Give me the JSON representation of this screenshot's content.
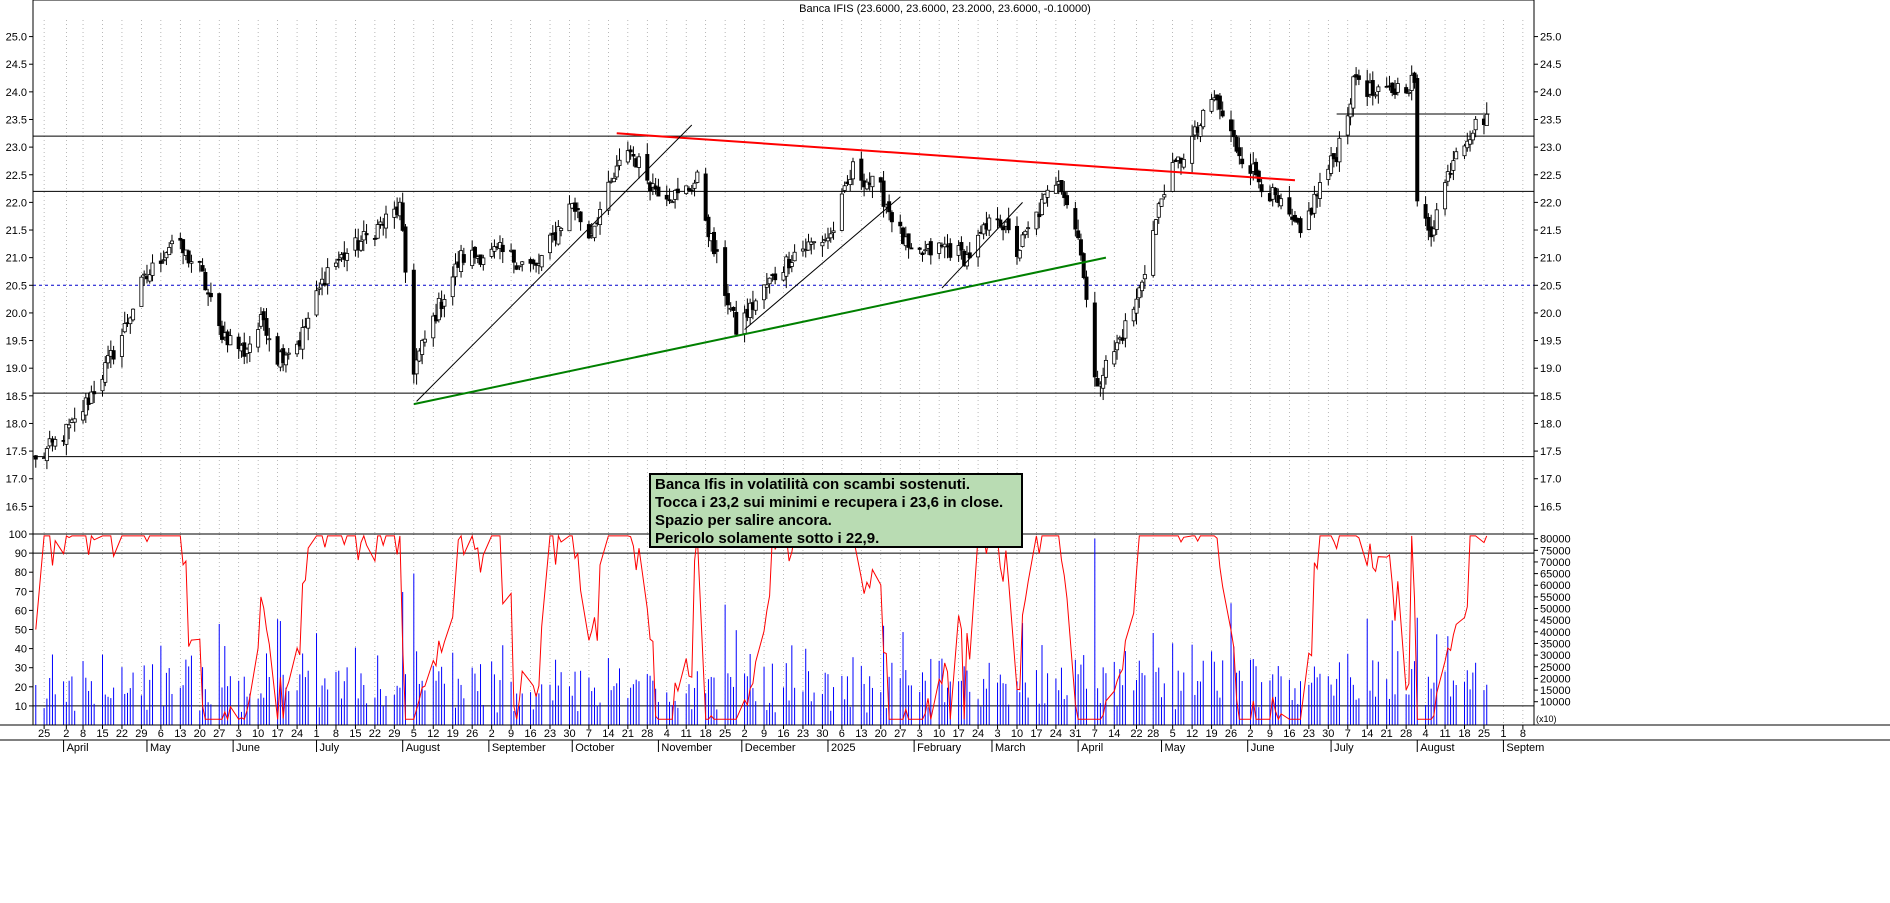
{
  "chart_data": [
    {
      "type": "candlestick",
      "title": "Banca IFIS (23.6000, 23.6000, 23.2000, 23.6000, -0.10000)",
      "ylim": [
        16.0,
        25.3
      ],
      "yticks": [
        16.5,
        17.0,
        17.5,
        18.0,
        18.5,
        19.0,
        19.5,
        20.0,
        20.5,
        21.0,
        21.5,
        22.0,
        22.5,
        23.0,
        23.5,
        24.0,
        24.5,
        25.0
      ],
      "ytick_labels": [
        "16.5",
        "17.0",
        "17.5",
        "18.0",
        "18.5",
        "19.0",
        "19.5",
        "20.0",
        "20.5",
        "21.0",
        "21.5",
        "22.0",
        "22.5",
        "23.0",
        "23.5",
        "24.0",
        "24.5",
        "25.0"
      ],
      "horizontal_levels": [
        23.2,
        22.2,
        18.55,
        17.4
      ],
      "dashed_level": 20.5,
      "close_series": {
        "start_date": "2024-03-22",
        "end_date": "2025-08-26",
        "anchors": [
          {
            "date": "2024-03-22",
            "value": 17.3
          },
          {
            "date": "2024-04-05",
            "value": 18.0
          },
          {
            "date": "2024-04-15",
            "value": 18.9
          },
          {
            "date": "2024-04-22",
            "value": 19.6
          },
          {
            "date": "2024-04-29",
            "value": 20.5
          },
          {
            "date": "2024-05-10",
            "value": 21.3
          },
          {
            "date": "2024-05-20",
            "value": 20.8
          },
          {
            "date": "2024-05-27",
            "value": 19.7
          },
          {
            "date": "2024-06-05",
            "value": 19.3
          },
          {
            "date": "2024-06-12",
            "value": 19.9
          },
          {
            "date": "2024-06-17",
            "value": 19.2
          },
          {
            "date": "2024-06-25",
            "value": 19.5
          },
          {
            "date": "2024-07-05",
            "value": 20.8
          },
          {
            "date": "2024-07-15",
            "value": 21.2
          },
          {
            "date": "2024-07-31",
            "value": 21.9
          },
          {
            "date": "2024-08-05",
            "value": 19.0
          },
          {
            "date": "2024-08-13",
            "value": 20.0
          },
          {
            "date": "2024-08-22",
            "value": 21.0
          },
          {
            "date": "2024-09-05",
            "value": 21.1
          },
          {
            "date": "2024-09-18",
            "value": 20.8
          },
          {
            "date": "2024-10-01",
            "value": 22.0
          },
          {
            "date": "2024-10-07",
            "value": 21.4
          },
          {
            "date": "2024-10-21",
            "value": 23.0
          },
          {
            "date": "2024-10-30",
            "value": 22.3
          },
          {
            "date": "2024-11-08",
            "value": 22.1
          },
          {
            "date": "2024-11-15",
            "value": 22.4
          },
          {
            "date": "2024-11-20",
            "value": 21.3
          },
          {
            "date": "2024-11-29",
            "value": 19.7
          },
          {
            "date": "2024-12-10",
            "value": 20.5
          },
          {
            "date": "2024-12-20",
            "value": 21.1
          },
          {
            "date": "2025-01-02",
            "value": 21.4
          },
          {
            "date": "2025-01-10",
            "value": 22.6
          },
          {
            "date": "2025-01-20",
            "value": 22.2
          },
          {
            "date": "2025-01-31",
            "value": 21.0
          },
          {
            "date": "2025-02-12",
            "value": 21.2
          },
          {
            "date": "2025-02-20",
            "value": 21.0
          },
          {
            "date": "2025-03-03",
            "value": 21.8
          },
          {
            "date": "2025-03-10",
            "value": 21.1
          },
          {
            "date": "2025-03-25",
            "value": 22.5
          },
          {
            "date": "2025-04-02",
            "value": 21.2
          },
          {
            "date": "2025-04-07",
            "value": 18.7
          },
          {
            "date": "2025-04-14",
            "value": 19.3
          },
          {
            "date": "2025-04-22",
            "value": 20.2
          },
          {
            "date": "2025-05-02",
            "value": 22.3
          },
          {
            "date": "2025-05-14",
            "value": 23.3
          },
          {
            "date": "2025-05-20",
            "value": 23.9
          },
          {
            "date": "2025-05-28",
            "value": 23.0
          },
          {
            "date": "2025-06-04",
            "value": 22.5
          },
          {
            "date": "2025-06-13",
            "value": 21.9
          },
          {
            "date": "2025-06-20",
            "value": 21.4
          },
          {
            "date": "2025-06-27",
            "value": 22.3
          },
          {
            "date": "2025-07-03",
            "value": 22.9
          },
          {
            "date": "2025-07-10",
            "value": 24.3
          },
          {
            "date": "2025-07-17",
            "value": 23.9
          },
          {
            "date": "2025-07-31",
            "value": 24.2
          },
          {
            "date": "2025-08-01",
            "value": 21.9
          },
          {
            "date": "2025-08-06",
            "value": 21.5
          },
          {
            "date": "2025-08-15",
            "value": 23.0
          },
          {
            "date": "2025-08-26",
            "value": 23.6
          }
        ]
      },
      "trendlines": [
        {
          "color": "#ff0000",
          "from": {
            "date": "2024-10-17",
            "value": 23.25
          },
          "to": {
            "date": "2025-06-18",
            "value": 22.4
          }
        },
        {
          "color": "#008000",
          "from": {
            "date": "2024-08-05",
            "value": 18.35
          },
          "to": {
            "date": "2025-04-11",
            "value": 21.0
          }
        },
        {
          "color": "#000000",
          "from": {
            "date": "2024-08-06",
            "value": 18.4
          },
          "to": {
            "date": "2024-11-13",
            "value": 23.4
          }
        },
        {
          "color": "#000000",
          "from": {
            "date": "2024-12-02",
            "value": 19.7
          },
          "to": {
            "date": "2025-01-27",
            "value": 22.1
          }
        },
        {
          "color": "#000000",
          "from": {
            "date": "2025-02-11",
            "value": 20.45
          },
          "to": {
            "date": "2025-03-12",
            "value": 22.0
          }
        },
        {
          "color": "#000000",
          "from": {
            "date": "2025-07-03",
            "value": 23.6
          },
          "to": {
            "date": "2025-08-27",
            "value": 23.6
          }
        }
      ],
      "annotation": [
        "Banca Ifis in volatilità con scambi sostenuti.",
        "Tocca i 23,2 sui minimi e recupera i 23,6 in close.",
        "Spazio per salire ancora.",
        "Pericolo solamente sotto i 22,9."
      ]
    },
    {
      "type": "line",
      "series": [
        {
          "color": "#ff0000"
        }
      ],
      "ylim": [
        0,
        100
      ],
      "yticks": [
        10,
        20,
        30,
        40,
        50,
        60,
        70,
        80,
        90,
        100
      ],
      "ytick_labels": [
        "10",
        "20",
        "30",
        "40",
        "50",
        "60",
        "70",
        "80",
        "90",
        "100"
      ],
      "levels": [
        90,
        10
      ]
    },
    {
      "type": "bar",
      "series": [
        {
          "color": "#0000ff"
        }
      ],
      "ylim": [
        0,
        82000
      ],
      "yticks": [
        10000,
        15000,
        20000,
        25000,
        30000,
        35000,
        40000,
        45000,
        50000,
        55000,
        60000,
        65000,
        70000,
        75000,
        80000
      ],
      "ytick_labels": [
        "10000",
        "15000",
        "20000",
        "25000",
        "30000",
        "35000",
        "40000",
        "45000",
        "50000",
        "55000",
        "60000",
        "65000",
        "70000",
        "75000",
        "80000"
      ],
      "unit_label": "(x10)"
    }
  ],
  "x_axis": {
    "day_ticks": [
      {
        "date": "2024-03-25",
        "label": "25"
      },
      {
        "date": "2024-04-02",
        "label": "2"
      },
      {
        "date": "2024-04-08",
        "label": "8"
      },
      {
        "date": "2024-04-15",
        "label": "15"
      },
      {
        "date": "2024-04-22",
        "label": "22"
      },
      {
        "date": "2024-04-29",
        "label": "29"
      },
      {
        "date": "2024-05-06",
        "label": "6"
      },
      {
        "date": "2024-05-13",
        "label": "13"
      },
      {
        "date": "2024-05-20",
        "label": "20"
      },
      {
        "date": "2024-05-27",
        "label": "27"
      },
      {
        "date": "2024-06-03",
        "label": "3"
      },
      {
        "date": "2024-06-10",
        "label": "10"
      },
      {
        "date": "2024-06-17",
        "label": "17"
      },
      {
        "date": "2024-06-24",
        "label": "24"
      },
      {
        "date": "2024-07-01",
        "label": "1"
      },
      {
        "date": "2024-07-08",
        "label": "8"
      },
      {
        "date": "2024-07-15",
        "label": "15"
      },
      {
        "date": "2024-07-22",
        "label": "22"
      },
      {
        "date": "2024-07-29",
        "label": "29"
      },
      {
        "date": "2024-08-05",
        "label": "5"
      },
      {
        "date": "2024-08-12",
        "label": "12"
      },
      {
        "date": "2024-08-19",
        "label": "19"
      },
      {
        "date": "2024-08-26",
        "label": "26"
      },
      {
        "date": "2024-09-02",
        "label": "2"
      },
      {
        "date": "2024-09-09",
        "label": "9"
      },
      {
        "date": "2024-09-16",
        "label": "16"
      },
      {
        "date": "2024-09-23",
        "label": "23"
      },
      {
        "date": "2024-09-30",
        "label": "30"
      },
      {
        "date": "2024-10-07",
        "label": "7"
      },
      {
        "date": "2024-10-14",
        "label": "14"
      },
      {
        "date": "2024-10-21",
        "label": "21"
      },
      {
        "date": "2024-10-28",
        "label": "28"
      },
      {
        "date": "2024-11-04",
        "label": "4"
      },
      {
        "date": "2024-11-11",
        "label": "11"
      },
      {
        "date": "2024-11-18",
        "label": "18"
      },
      {
        "date": "2024-11-25",
        "label": "25"
      },
      {
        "date": "2024-12-02",
        "label": "2"
      },
      {
        "date": "2024-12-09",
        "label": "9"
      },
      {
        "date": "2024-12-16",
        "label": "16"
      },
      {
        "date": "2024-12-23",
        "label": "23"
      },
      {
        "date": "2024-12-30",
        "label": "30"
      },
      {
        "date": "2025-01-06",
        "label": "6"
      },
      {
        "date": "2025-01-13",
        "label": "13"
      },
      {
        "date": "2025-01-20",
        "label": "20"
      },
      {
        "date": "2025-01-27",
        "label": "27"
      },
      {
        "date": "2025-02-03",
        "label": "3"
      },
      {
        "date": "2025-02-10",
        "label": "10"
      },
      {
        "date": "2025-02-17",
        "label": "17"
      },
      {
        "date": "2025-02-24",
        "label": "24"
      },
      {
        "date": "2025-03-03",
        "label": "3"
      },
      {
        "date": "2025-03-10",
        "label": "10"
      },
      {
        "date": "2025-03-17",
        "label": "17"
      },
      {
        "date": "2025-03-24",
        "label": "24"
      },
      {
        "date": "2025-03-31",
        "label": "31"
      },
      {
        "date": "2025-04-07",
        "label": "7"
      },
      {
        "date": "2025-04-14",
        "label": "14"
      },
      {
        "date": "2025-04-22",
        "label": "22"
      },
      {
        "date": "2025-04-28",
        "label": "28"
      },
      {
        "date": "2025-05-05",
        "label": "5"
      },
      {
        "date": "2025-05-12",
        "label": "12"
      },
      {
        "date": "2025-05-19",
        "label": "19"
      },
      {
        "date": "2025-05-26",
        "label": "26"
      },
      {
        "date": "2025-06-02",
        "label": "2"
      },
      {
        "date": "2025-06-09",
        "label": "9"
      },
      {
        "date": "2025-06-16",
        "label": "16"
      },
      {
        "date": "2025-06-23",
        "label": "23"
      },
      {
        "date": "2025-06-30",
        "label": "30"
      },
      {
        "date": "2025-07-07",
        "label": "7"
      },
      {
        "date": "2025-07-14",
        "label": "14"
      },
      {
        "date": "2025-07-21",
        "label": "21"
      },
      {
        "date": "2025-07-28",
        "label": "28"
      },
      {
        "date": "2025-08-04",
        "label": "4"
      },
      {
        "date": "2025-08-11",
        "label": "11"
      },
      {
        "date": "2025-08-18",
        "label": "18"
      },
      {
        "date": "2025-08-25",
        "label": "25"
      },
      {
        "date": "2025-09-01",
        "label": "1"
      },
      {
        "date": "2025-09-08",
        "label": "8"
      }
    ],
    "month_ticks": [
      {
        "date": "2024-04-01",
        "label": "April"
      },
      {
        "date": "2024-05-01",
        "label": "May"
      },
      {
        "date": "2024-06-01",
        "label": "June"
      },
      {
        "date": "2024-07-01",
        "label": "July"
      },
      {
        "date": "2024-08-01",
        "label": "August"
      },
      {
        "date": "2024-09-01",
        "label": "September"
      },
      {
        "date": "2024-10-01",
        "label": "October"
      },
      {
        "date": "2024-11-01",
        "label": "November"
      },
      {
        "date": "2024-12-01",
        "label": "December"
      },
      {
        "date": "2025-01-01",
        "label": "2025"
      },
      {
        "date": "2025-02-01",
        "label": "February"
      },
      {
        "date": "2025-03-01",
        "label": "March"
      },
      {
        "date": "2025-04-01",
        "label": "April"
      },
      {
        "date": "2025-05-01",
        "label": "May"
      },
      {
        "date": "2025-06-01",
        "label": "June"
      },
      {
        "date": "2025-07-01",
        "label": "July"
      },
      {
        "date": "2025-08-01",
        "label": "August"
      },
      {
        "date": "2025-09-01",
        "label": "Septem"
      }
    ]
  },
  "colors": {
    "candle": "#000000",
    "oscillator": "#ff0000",
    "volume": "#0000ff",
    "grid": "#9a9a9a",
    "dashed_level": "#0000cc",
    "note_background": "#b9dcb3"
  }
}
